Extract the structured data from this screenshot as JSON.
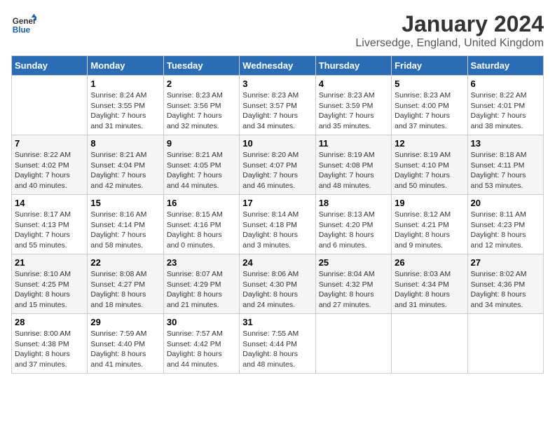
{
  "header": {
    "logo_general": "General",
    "logo_blue": "Blue",
    "month_year": "January 2024",
    "location": "Liversedge, England, United Kingdom"
  },
  "days_of_week": [
    "Sunday",
    "Monday",
    "Tuesday",
    "Wednesday",
    "Thursday",
    "Friday",
    "Saturday"
  ],
  "weeks": [
    [
      {
        "day": "",
        "info": ""
      },
      {
        "day": "1",
        "info": "Sunrise: 8:24 AM\nSunset: 3:55 PM\nDaylight: 7 hours\nand 31 minutes."
      },
      {
        "day": "2",
        "info": "Sunrise: 8:23 AM\nSunset: 3:56 PM\nDaylight: 7 hours\nand 32 minutes."
      },
      {
        "day": "3",
        "info": "Sunrise: 8:23 AM\nSunset: 3:57 PM\nDaylight: 7 hours\nand 34 minutes."
      },
      {
        "day": "4",
        "info": "Sunrise: 8:23 AM\nSunset: 3:59 PM\nDaylight: 7 hours\nand 35 minutes."
      },
      {
        "day": "5",
        "info": "Sunrise: 8:23 AM\nSunset: 4:00 PM\nDaylight: 7 hours\nand 37 minutes."
      },
      {
        "day": "6",
        "info": "Sunrise: 8:22 AM\nSunset: 4:01 PM\nDaylight: 7 hours\nand 38 minutes."
      }
    ],
    [
      {
        "day": "7",
        "info": "Sunrise: 8:22 AM\nSunset: 4:02 PM\nDaylight: 7 hours\nand 40 minutes."
      },
      {
        "day": "8",
        "info": "Sunrise: 8:21 AM\nSunset: 4:04 PM\nDaylight: 7 hours\nand 42 minutes."
      },
      {
        "day": "9",
        "info": "Sunrise: 8:21 AM\nSunset: 4:05 PM\nDaylight: 7 hours\nand 44 minutes."
      },
      {
        "day": "10",
        "info": "Sunrise: 8:20 AM\nSunset: 4:07 PM\nDaylight: 7 hours\nand 46 minutes."
      },
      {
        "day": "11",
        "info": "Sunrise: 8:19 AM\nSunset: 4:08 PM\nDaylight: 7 hours\nand 48 minutes."
      },
      {
        "day": "12",
        "info": "Sunrise: 8:19 AM\nSunset: 4:10 PM\nDaylight: 7 hours\nand 50 minutes."
      },
      {
        "day": "13",
        "info": "Sunrise: 8:18 AM\nSunset: 4:11 PM\nDaylight: 7 hours\nand 53 minutes."
      }
    ],
    [
      {
        "day": "14",
        "info": "Sunrise: 8:17 AM\nSunset: 4:13 PM\nDaylight: 7 hours\nand 55 minutes."
      },
      {
        "day": "15",
        "info": "Sunrise: 8:16 AM\nSunset: 4:14 PM\nDaylight: 7 hours\nand 58 minutes."
      },
      {
        "day": "16",
        "info": "Sunrise: 8:15 AM\nSunset: 4:16 PM\nDaylight: 8 hours\nand 0 minutes."
      },
      {
        "day": "17",
        "info": "Sunrise: 8:14 AM\nSunset: 4:18 PM\nDaylight: 8 hours\nand 3 minutes."
      },
      {
        "day": "18",
        "info": "Sunrise: 8:13 AM\nSunset: 4:20 PM\nDaylight: 8 hours\nand 6 minutes."
      },
      {
        "day": "19",
        "info": "Sunrise: 8:12 AM\nSunset: 4:21 PM\nDaylight: 8 hours\nand 9 minutes."
      },
      {
        "day": "20",
        "info": "Sunrise: 8:11 AM\nSunset: 4:23 PM\nDaylight: 8 hours\nand 12 minutes."
      }
    ],
    [
      {
        "day": "21",
        "info": "Sunrise: 8:10 AM\nSunset: 4:25 PM\nDaylight: 8 hours\nand 15 minutes."
      },
      {
        "day": "22",
        "info": "Sunrise: 8:08 AM\nSunset: 4:27 PM\nDaylight: 8 hours\nand 18 minutes."
      },
      {
        "day": "23",
        "info": "Sunrise: 8:07 AM\nSunset: 4:29 PM\nDaylight: 8 hours\nand 21 minutes."
      },
      {
        "day": "24",
        "info": "Sunrise: 8:06 AM\nSunset: 4:30 PM\nDaylight: 8 hours\nand 24 minutes."
      },
      {
        "day": "25",
        "info": "Sunrise: 8:04 AM\nSunset: 4:32 PM\nDaylight: 8 hours\nand 27 minutes."
      },
      {
        "day": "26",
        "info": "Sunrise: 8:03 AM\nSunset: 4:34 PM\nDaylight: 8 hours\nand 31 minutes."
      },
      {
        "day": "27",
        "info": "Sunrise: 8:02 AM\nSunset: 4:36 PM\nDaylight: 8 hours\nand 34 minutes."
      }
    ],
    [
      {
        "day": "28",
        "info": "Sunrise: 8:00 AM\nSunset: 4:38 PM\nDaylight: 8 hours\nand 37 minutes."
      },
      {
        "day": "29",
        "info": "Sunrise: 7:59 AM\nSunset: 4:40 PM\nDaylight: 8 hours\nand 41 minutes."
      },
      {
        "day": "30",
        "info": "Sunrise: 7:57 AM\nSunset: 4:42 PM\nDaylight: 8 hours\nand 44 minutes."
      },
      {
        "day": "31",
        "info": "Sunrise: 7:55 AM\nSunset: 4:44 PM\nDaylight: 8 hours\nand 48 minutes."
      },
      {
        "day": "",
        "info": ""
      },
      {
        "day": "",
        "info": ""
      },
      {
        "day": "",
        "info": ""
      }
    ]
  ]
}
